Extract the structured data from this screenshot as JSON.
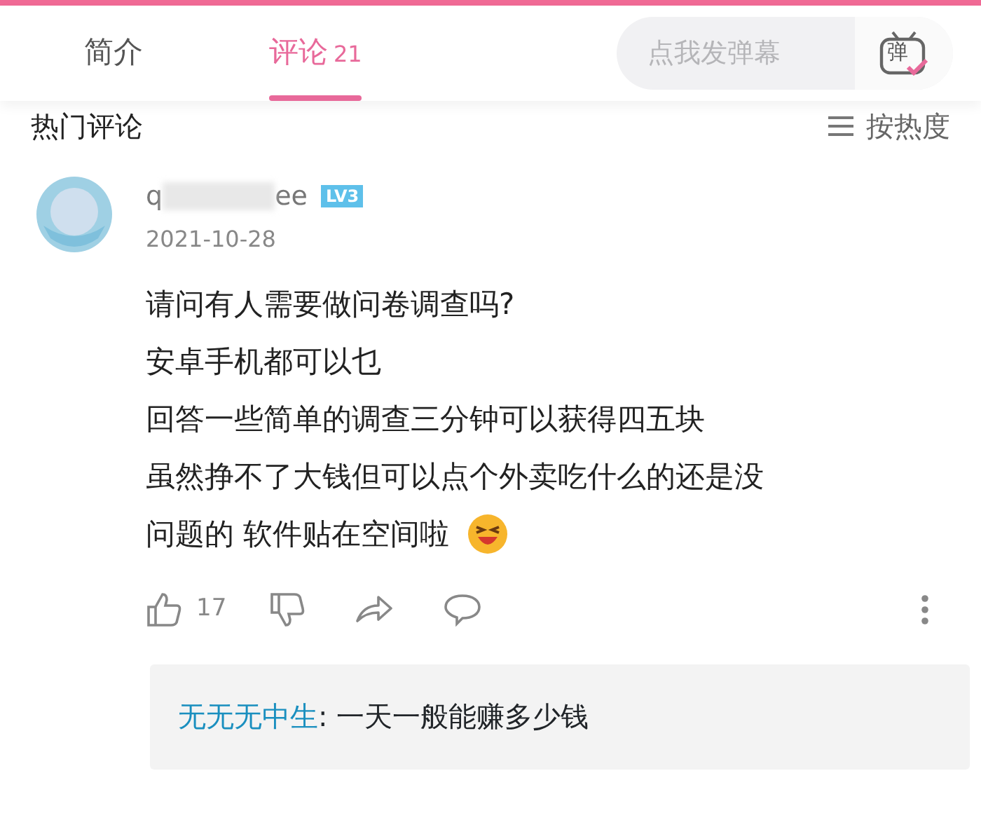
{
  "tabs": [
    {
      "label": "简介",
      "selected": false
    },
    {
      "label": "评论",
      "count": "21",
      "selected": true
    }
  ],
  "danmaku": {
    "placeholder": "点我发弹幕",
    "icon_label": "弹"
  },
  "section": {
    "title": "热门评论",
    "sort_label": "按热度"
  },
  "comment": {
    "username_parts": [
      "q",
      "ee"
    ],
    "level": "LV3",
    "date": "2021-10-28",
    "lines": [
      "请问有人需要做问卷调查吗?",
      "安卓手机都可以乜",
      "回答一些简单的调查三分钟可以获得四五块",
      "虽然挣不了大钱但可以点个外卖吃什么的还是没",
      "问题的 软件贴在空间啦"
    ],
    "likes": "17",
    "reply": {
      "author": "无无无中生",
      "text": ": 一天一般能赚多少钱"
    }
  }
}
